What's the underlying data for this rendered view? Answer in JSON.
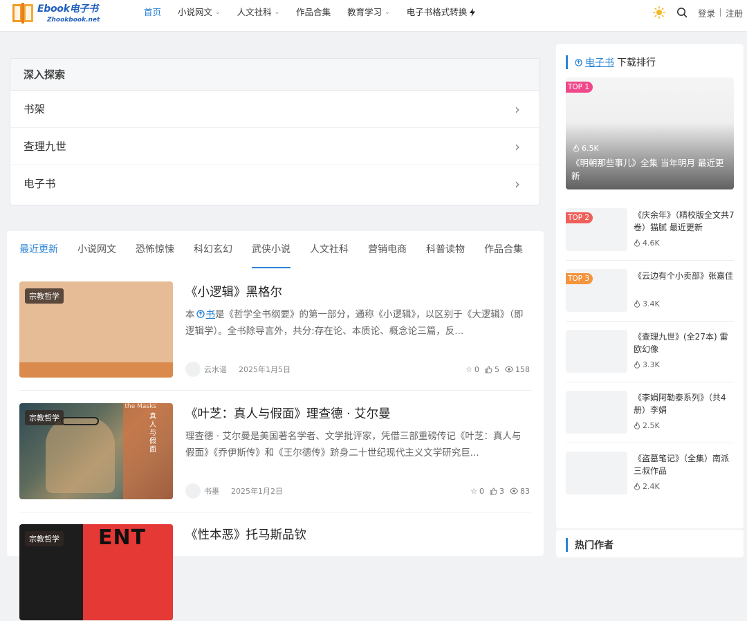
{
  "header": {
    "logo_text": "Ebook电子书",
    "logo_sub": "Zhookbook.net",
    "nav": [
      {
        "label": "首页",
        "active": true,
        "dropdown": false
      },
      {
        "label": "小说网文",
        "active": false,
        "dropdown": true
      },
      {
        "label": "人文社科",
        "active": false,
        "dropdown": true
      },
      {
        "label": "作品合集",
        "active": false,
        "dropdown": false
      },
      {
        "label": "教育学习",
        "active": false,
        "dropdown": true
      },
      {
        "label": "电子书格式转换",
        "active": false,
        "dropdown": false
      }
    ],
    "login": "登录",
    "register": "注册"
  },
  "explore": {
    "title": "深入探索",
    "items": [
      "书架",
      "查理九世",
      "电子书"
    ]
  },
  "tabs": [
    "最近更新",
    "小说网文",
    "恐怖惊悚",
    "科幻玄幻",
    "武侠小说",
    "人文社科",
    "营销电商",
    "科普读物",
    "作品合集"
  ],
  "posts": [
    {
      "category": "宗教哲学",
      "title": "《小逻辑》黑格尔",
      "excerpt_pre": "本",
      "excerpt_link": "书",
      "excerpt_post": "是《哲学全书纲要》的第一部分，通称《小逻辑》，以区别于《大逻辑》（即逻辑学）。全书除导言外，共分:存在论、本质论、概念论三篇，反...",
      "author": "云水谣",
      "date": "2025年1月5日",
      "stars": "0",
      "likes": "5",
      "views": "158"
    },
    {
      "category": "宗教哲学",
      "title": "《叶芝：真人与假面》理查德 · 艾尔曼",
      "excerpt": "理查德 · 艾尔曼是美国著名学者、文学批评家，凭借三部重磅传记《叶芝：真人与假面》《乔伊斯传》和《王尔德传》跻身二十世纪现代主义文学研究巨...",
      "author": "书墨",
      "date": "2025年1月2日",
      "stars": "0",
      "likes": "3",
      "views": "83",
      "cover_text": "真人与假面",
      "cover_caption": "the Masks"
    },
    {
      "category": "宗教哲学",
      "title": "《性本恶》托马斯品钦",
      "cover_text": "ENT"
    }
  ],
  "sidebar": {
    "title_link": "电子书",
    "title_rest": "下载排行",
    "top": {
      "tag": "TOP 1",
      "count": "6.5K",
      "title": "《明朝那些事儿》全集 当年明月 最近更新"
    },
    "items": [
      {
        "tag": "TOP 2",
        "tag_color": "#f0605a",
        "title": "《庆余年》（精校版全文共7卷）猫腻 最近更新",
        "count": "4.6K"
      },
      {
        "tag": "TOP 3",
        "tag_color": "#f4943e",
        "title": "《云边有个小卖部》张嘉佳",
        "count": "3.4K"
      },
      {
        "tag": "",
        "title": "《查理九世》(全27本) 雷欧幻像",
        "count": "3.3K"
      },
      {
        "tag": "",
        "title": "《李娟阿勒泰系列》（共4册）李娟",
        "count": "2.5K"
      },
      {
        "tag": "",
        "title": "《盗墓笔记》（全集）南派三叔作品",
        "count": "2.4K"
      }
    ],
    "hot_authors_title": "热门作者"
  },
  "colors": {
    "accent": "#2b84d6",
    "top1": "#f0488a"
  }
}
